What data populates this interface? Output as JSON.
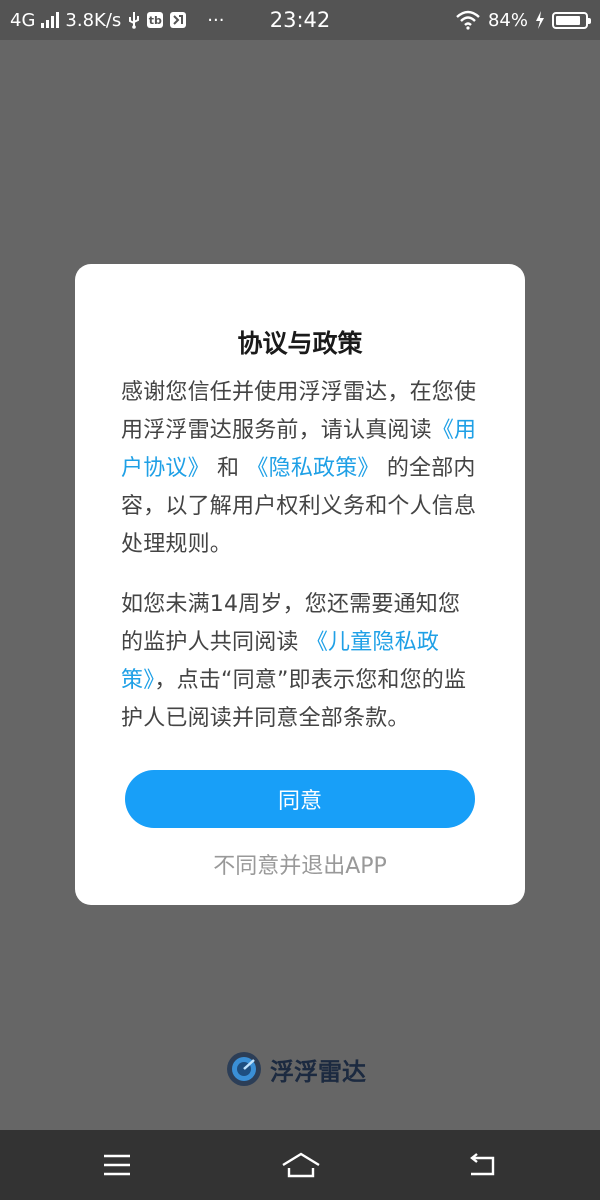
{
  "status_bar": {
    "network": "4G",
    "speed": "3.8K/s",
    "usb_icon": "usb-icon",
    "app_icon_1": "tb",
    "time": "23:42",
    "more": "···",
    "battery_percent": "84%",
    "battery_level": 0.84
  },
  "dialog": {
    "title": "协议与政策",
    "para1_a": "感谢您信任并使用浮浮雷达，在您使用浮浮雷达服务前，请认真阅读",
    "user_agreement_link": "《用户协议》",
    "para1_and": "和",
    "privacy_policy_link": "《隐私政策》",
    "para1_b": "的全部内容，以了解用户权利义务和个人信息处理规则。",
    "para2_a": "如您未满14周岁，您还需要通知您的监护人共同阅读",
    "child_privacy_link": "《儿童隐私政策》",
    "para2_b": "，点击“同意”即表示您和您的监护人已阅读并同意全部条款。",
    "agree_label": "同意",
    "decline_label": "不同意并退出APP"
  },
  "brand": {
    "name": "浮浮雷达"
  },
  "colors": {
    "accent": "#189ff8",
    "link": "#1fa0e6",
    "overlay": "#666666"
  }
}
